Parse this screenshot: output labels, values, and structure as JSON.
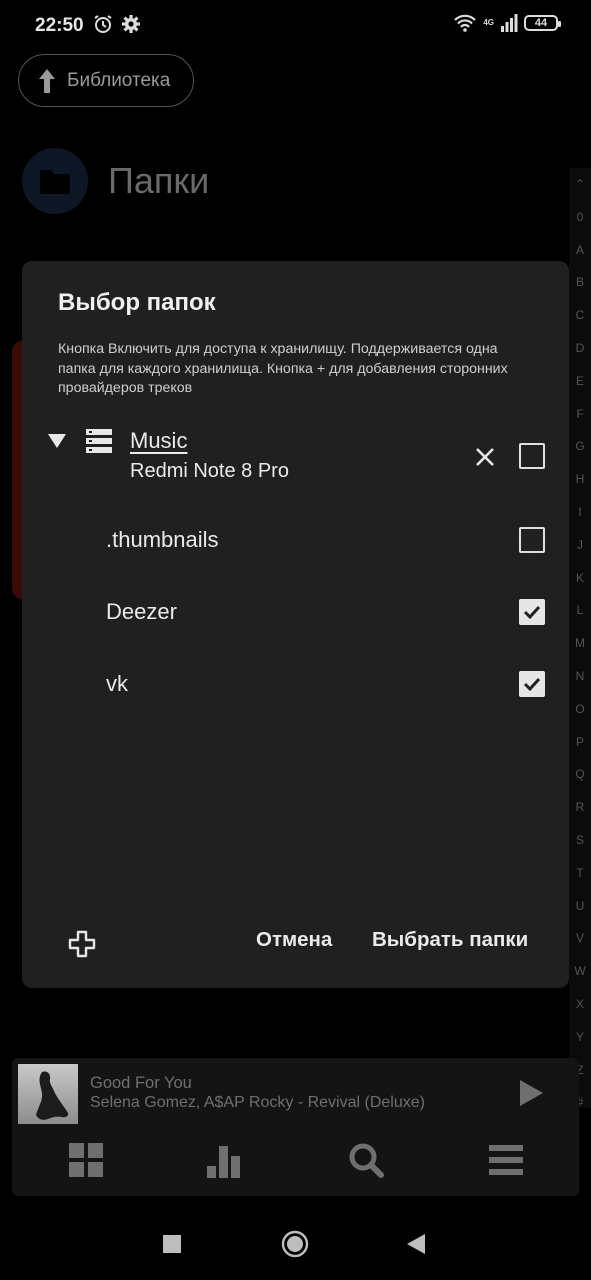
{
  "status": {
    "time": "22:50",
    "network": "4G",
    "battery": "44"
  },
  "background": {
    "library_button": "Библиотека",
    "page_title": "Папки",
    "alpha_index": [
      "⌃",
      "0",
      "A",
      "B",
      "C",
      "D",
      "E",
      "F",
      "G",
      "H",
      "I",
      "J",
      "K",
      "L",
      "M",
      "N",
      "O",
      "P",
      "Q",
      "R",
      "S",
      "T",
      "U",
      "V",
      "W",
      "X",
      "Y",
      "Z",
      "#"
    ]
  },
  "dialog": {
    "title": "Выбор папок",
    "description": "Кнопка Включить для доступа к хранилищу. Поддерживается одна папка для каждого хранилища. Кнопка + для добавления сторонних провайдеров треков",
    "root": {
      "name": "Music",
      "device": "Redmi Note 8 Pro",
      "checked": false
    },
    "folders": [
      {
        "name": ".thumbnails",
        "checked": false
      },
      {
        "name": "Deezer",
        "checked": true
      },
      {
        "name": "vk",
        "checked": true
      }
    ],
    "cancel_label": "Отмена",
    "confirm_label": "Выбрать папки"
  },
  "player": {
    "title": "Good For You",
    "subtitle": "Selena Gomez, A$AP Rocky - Revival (Deluxe)"
  },
  "icons": {
    "nav": [
      "grid-icon",
      "charts-icon",
      "search-icon",
      "menu-icon"
    ]
  }
}
